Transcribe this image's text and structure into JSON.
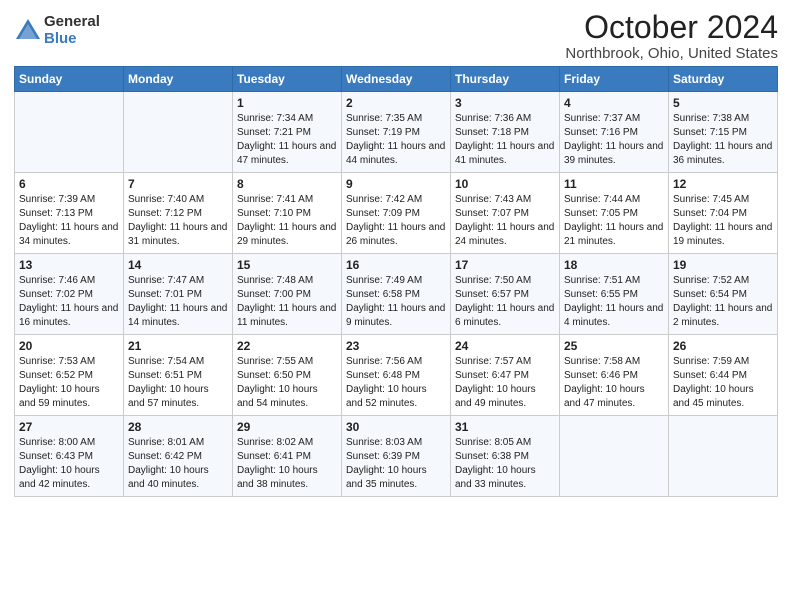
{
  "header": {
    "logo_general": "General",
    "logo_blue": "Blue",
    "month_title": "October 2024",
    "location": "Northbrook, Ohio, United States"
  },
  "days_of_week": [
    "Sunday",
    "Monday",
    "Tuesday",
    "Wednesday",
    "Thursday",
    "Friday",
    "Saturday"
  ],
  "weeks": [
    [
      {
        "day": "",
        "sunrise": "",
        "sunset": "",
        "daylight": ""
      },
      {
        "day": "",
        "sunrise": "",
        "sunset": "",
        "daylight": ""
      },
      {
        "day": "1",
        "sunrise": "Sunrise: 7:34 AM",
        "sunset": "Sunset: 7:21 PM",
        "daylight": "Daylight: 11 hours and 47 minutes."
      },
      {
        "day": "2",
        "sunrise": "Sunrise: 7:35 AM",
        "sunset": "Sunset: 7:19 PM",
        "daylight": "Daylight: 11 hours and 44 minutes."
      },
      {
        "day": "3",
        "sunrise": "Sunrise: 7:36 AM",
        "sunset": "Sunset: 7:18 PM",
        "daylight": "Daylight: 11 hours and 41 minutes."
      },
      {
        "day": "4",
        "sunrise": "Sunrise: 7:37 AM",
        "sunset": "Sunset: 7:16 PM",
        "daylight": "Daylight: 11 hours and 39 minutes."
      },
      {
        "day": "5",
        "sunrise": "Sunrise: 7:38 AM",
        "sunset": "Sunset: 7:15 PM",
        "daylight": "Daylight: 11 hours and 36 minutes."
      }
    ],
    [
      {
        "day": "6",
        "sunrise": "Sunrise: 7:39 AM",
        "sunset": "Sunset: 7:13 PM",
        "daylight": "Daylight: 11 hours and 34 minutes."
      },
      {
        "day": "7",
        "sunrise": "Sunrise: 7:40 AM",
        "sunset": "Sunset: 7:12 PM",
        "daylight": "Daylight: 11 hours and 31 minutes."
      },
      {
        "day": "8",
        "sunrise": "Sunrise: 7:41 AM",
        "sunset": "Sunset: 7:10 PM",
        "daylight": "Daylight: 11 hours and 29 minutes."
      },
      {
        "day": "9",
        "sunrise": "Sunrise: 7:42 AM",
        "sunset": "Sunset: 7:09 PM",
        "daylight": "Daylight: 11 hours and 26 minutes."
      },
      {
        "day": "10",
        "sunrise": "Sunrise: 7:43 AM",
        "sunset": "Sunset: 7:07 PM",
        "daylight": "Daylight: 11 hours and 24 minutes."
      },
      {
        "day": "11",
        "sunrise": "Sunrise: 7:44 AM",
        "sunset": "Sunset: 7:05 PM",
        "daylight": "Daylight: 11 hours and 21 minutes."
      },
      {
        "day": "12",
        "sunrise": "Sunrise: 7:45 AM",
        "sunset": "Sunset: 7:04 PM",
        "daylight": "Daylight: 11 hours and 19 minutes."
      }
    ],
    [
      {
        "day": "13",
        "sunrise": "Sunrise: 7:46 AM",
        "sunset": "Sunset: 7:02 PM",
        "daylight": "Daylight: 11 hours and 16 minutes."
      },
      {
        "day": "14",
        "sunrise": "Sunrise: 7:47 AM",
        "sunset": "Sunset: 7:01 PM",
        "daylight": "Daylight: 11 hours and 14 minutes."
      },
      {
        "day": "15",
        "sunrise": "Sunrise: 7:48 AM",
        "sunset": "Sunset: 7:00 PM",
        "daylight": "Daylight: 11 hours and 11 minutes."
      },
      {
        "day": "16",
        "sunrise": "Sunrise: 7:49 AM",
        "sunset": "Sunset: 6:58 PM",
        "daylight": "Daylight: 11 hours and 9 minutes."
      },
      {
        "day": "17",
        "sunrise": "Sunrise: 7:50 AM",
        "sunset": "Sunset: 6:57 PM",
        "daylight": "Daylight: 11 hours and 6 minutes."
      },
      {
        "day": "18",
        "sunrise": "Sunrise: 7:51 AM",
        "sunset": "Sunset: 6:55 PM",
        "daylight": "Daylight: 11 hours and 4 minutes."
      },
      {
        "day": "19",
        "sunrise": "Sunrise: 7:52 AM",
        "sunset": "Sunset: 6:54 PM",
        "daylight": "Daylight: 11 hours and 2 minutes."
      }
    ],
    [
      {
        "day": "20",
        "sunrise": "Sunrise: 7:53 AM",
        "sunset": "Sunset: 6:52 PM",
        "daylight": "Daylight: 10 hours and 59 minutes."
      },
      {
        "day": "21",
        "sunrise": "Sunrise: 7:54 AM",
        "sunset": "Sunset: 6:51 PM",
        "daylight": "Daylight: 10 hours and 57 minutes."
      },
      {
        "day": "22",
        "sunrise": "Sunrise: 7:55 AM",
        "sunset": "Sunset: 6:50 PM",
        "daylight": "Daylight: 10 hours and 54 minutes."
      },
      {
        "day": "23",
        "sunrise": "Sunrise: 7:56 AM",
        "sunset": "Sunset: 6:48 PM",
        "daylight": "Daylight: 10 hours and 52 minutes."
      },
      {
        "day": "24",
        "sunrise": "Sunrise: 7:57 AM",
        "sunset": "Sunset: 6:47 PM",
        "daylight": "Daylight: 10 hours and 49 minutes."
      },
      {
        "day": "25",
        "sunrise": "Sunrise: 7:58 AM",
        "sunset": "Sunset: 6:46 PM",
        "daylight": "Daylight: 10 hours and 47 minutes."
      },
      {
        "day": "26",
        "sunrise": "Sunrise: 7:59 AM",
        "sunset": "Sunset: 6:44 PM",
        "daylight": "Daylight: 10 hours and 45 minutes."
      }
    ],
    [
      {
        "day": "27",
        "sunrise": "Sunrise: 8:00 AM",
        "sunset": "Sunset: 6:43 PM",
        "daylight": "Daylight: 10 hours and 42 minutes."
      },
      {
        "day": "28",
        "sunrise": "Sunrise: 8:01 AM",
        "sunset": "Sunset: 6:42 PM",
        "daylight": "Daylight: 10 hours and 40 minutes."
      },
      {
        "day": "29",
        "sunrise": "Sunrise: 8:02 AM",
        "sunset": "Sunset: 6:41 PM",
        "daylight": "Daylight: 10 hours and 38 minutes."
      },
      {
        "day": "30",
        "sunrise": "Sunrise: 8:03 AM",
        "sunset": "Sunset: 6:39 PM",
        "daylight": "Daylight: 10 hours and 35 minutes."
      },
      {
        "day": "31",
        "sunrise": "Sunrise: 8:05 AM",
        "sunset": "Sunset: 6:38 PM",
        "daylight": "Daylight: 10 hours and 33 minutes."
      },
      {
        "day": "",
        "sunrise": "",
        "sunset": "",
        "daylight": ""
      },
      {
        "day": "",
        "sunrise": "",
        "sunset": "",
        "daylight": ""
      }
    ]
  ]
}
